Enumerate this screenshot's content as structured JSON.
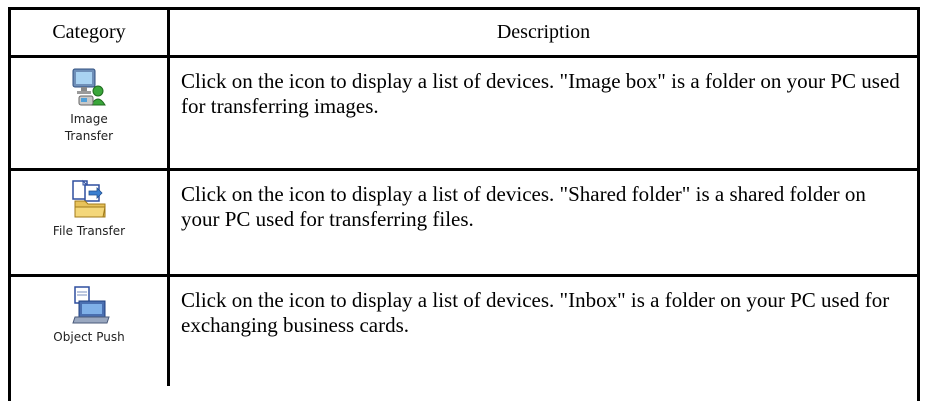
{
  "table": {
    "headers": {
      "category": "Category",
      "description": "Description"
    },
    "rows": [
      {
        "icon": "image-transfer-icon",
        "category": "Image\nTransfer",
        "description": "Click on the icon to display a list of devices. \"Image box\" is a folder on your PC used for transferring images."
      },
      {
        "icon": "file-transfer-icon",
        "category": "File Transfer",
        "description": "Click on the icon to display a list of devices. \"Shared folder\" is a shared folder on your PC used for transferring files."
      },
      {
        "icon": "object-push-icon",
        "category": "Object Push",
        "description": "Click on the icon to display a list of devices. \"Inbox\" is a folder on your PC used for exchanging business cards."
      }
    ]
  }
}
